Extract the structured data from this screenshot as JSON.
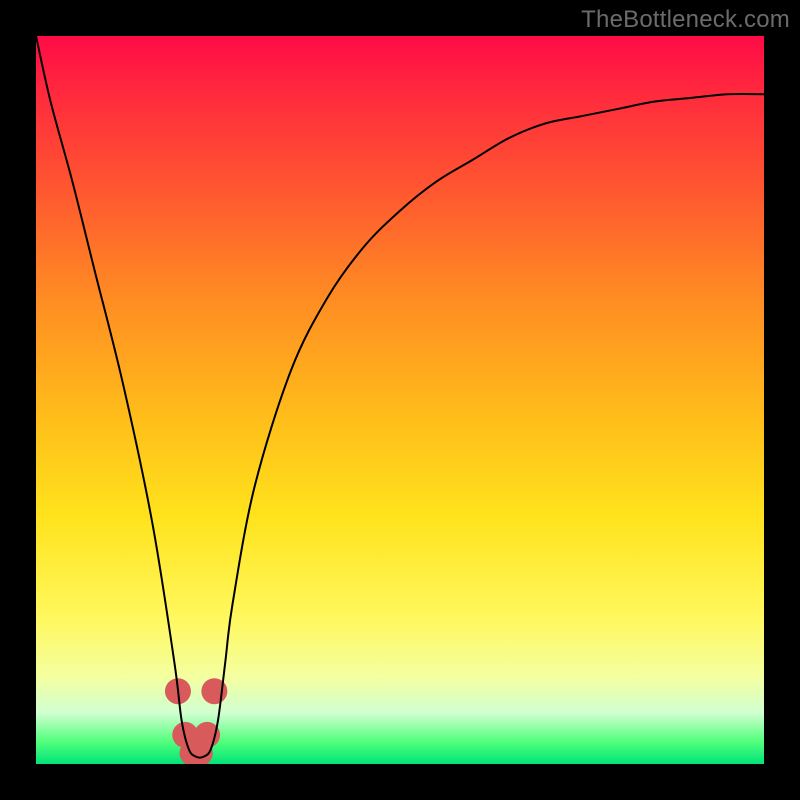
{
  "watermark": "TheBottleneck.com",
  "chart_data": {
    "type": "line",
    "title": "",
    "xlabel": "",
    "ylabel": "",
    "xlim": [
      0,
      100
    ],
    "ylim": [
      0,
      100
    ],
    "series": [
      {
        "name": "curve",
        "x": [
          0,
          2,
          5,
          8,
          12,
          16,
          19,
          20,
          21,
          22,
          23,
          24,
          25,
          26,
          27,
          30,
          35,
          40,
          45,
          50,
          55,
          60,
          65,
          70,
          75,
          80,
          85,
          90,
          95,
          100
        ],
        "values": [
          100,
          91,
          80,
          68,
          52,
          33,
          14,
          6,
          2,
          1,
          1,
          2,
          6,
          14,
          22,
          38,
          54,
          64,
          71,
          76,
          80,
          83,
          86,
          88,
          89,
          90,
          91,
          91.5,
          92,
          92
        ]
      }
    ],
    "markers": {
      "name": "highlight",
      "x": [
        19.5,
        20.5,
        21.5,
        22.5,
        23.5,
        24.5
      ],
      "values": [
        10,
        4,
        1.5,
        1.5,
        4,
        10
      ]
    },
    "gradient_bands": [
      "red",
      "orange",
      "yellow",
      "green"
    ]
  }
}
